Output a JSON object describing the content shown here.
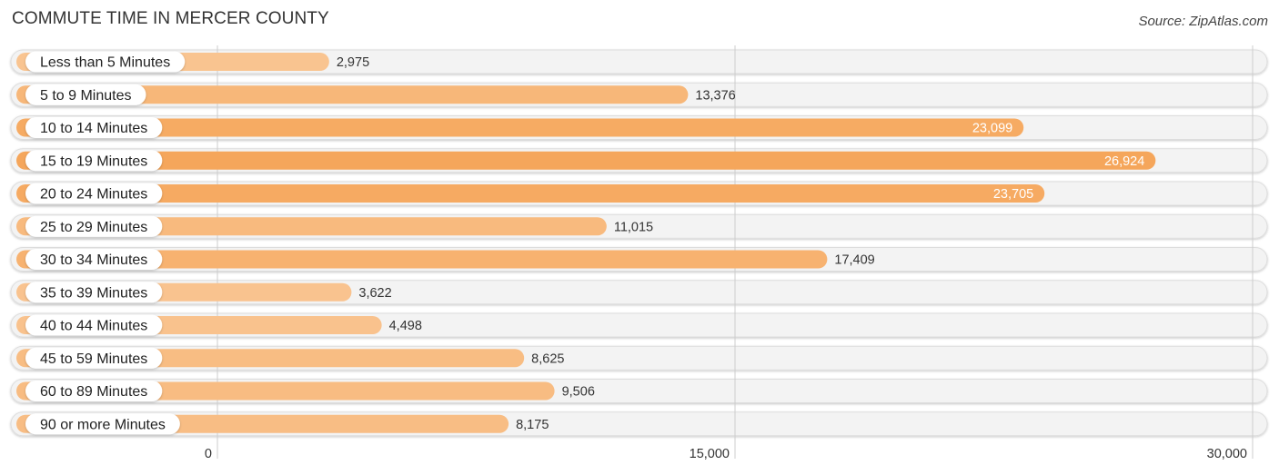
{
  "header": {
    "title": "COMMUTE TIME IN MERCER COUNTY",
    "source": "Source: ZipAtlas.com"
  },
  "colors": {
    "bar_light": "#f9c490",
    "bar_mid": "#f7b577",
    "bar_strong": "#f5a65b",
    "track": "#f3f3f3",
    "track_border": "#dddddd",
    "gridline": "#cccccc",
    "value_dark": "#333333",
    "value_light": "#ffffff"
  },
  "chart_data": {
    "type": "bar",
    "orientation": "horizontal",
    "title": "COMMUTE TIME IN MERCER COUNTY",
    "xlabel": "",
    "ylabel": "",
    "xlim": [
      0,
      30000
    ],
    "xticks": [
      0,
      15000,
      30000
    ],
    "xtick_labels": [
      "0",
      "15,000",
      "30,000"
    ],
    "grid": true,
    "categories": [
      "Less than 5 Minutes",
      "5 to 9 Minutes",
      "10 to 14 Minutes",
      "15 to 19 Minutes",
      "20 to 24 Minutes",
      "25 to 29 Minutes",
      "30 to 34 Minutes",
      "35 to 39 Minutes",
      "40 to 44 Minutes",
      "45 to 59 Minutes",
      "60 to 89 Minutes",
      "90 or more Minutes"
    ],
    "values": [
      2975,
      13376,
      23099,
      26924,
      23705,
      11015,
      17409,
      3622,
      4498,
      8625,
      9506,
      8175
    ],
    "value_labels": [
      "2,975",
      "13,376",
      "23,099",
      "26,924",
      "23,705",
      "11,015",
      "17,409",
      "3,622",
      "4,498",
      "8,625",
      "9,506",
      "8,175"
    ]
  }
}
